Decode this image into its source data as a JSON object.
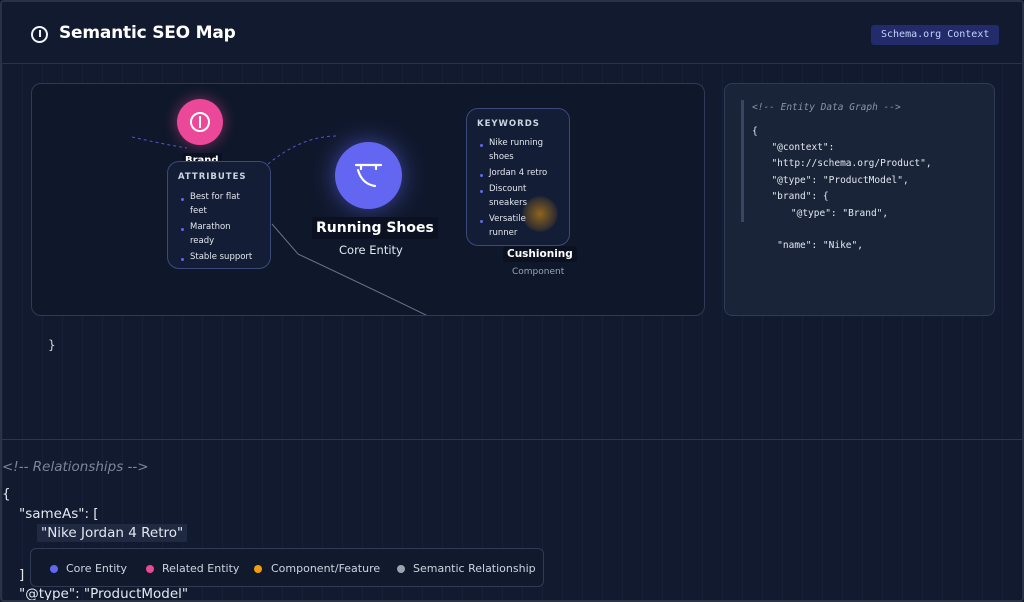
{
  "header": {
    "title": "Semantic SEO Map",
    "badge": "Schema.org Context"
  },
  "map": {
    "brand_label": "Brand",
    "core_label": "Running Shoes",
    "core_sublabel": "Core Entity",
    "component_label": "Cushioning",
    "component_sublabel": "Component",
    "attributes": {
      "title": "ATTRIBUTES",
      "items": [
        "Best for flat",
        "feet",
        "Marathon",
        "ready",
        "Stable support"
      ]
    },
    "keywords": {
      "title": "KEYWORDS",
      "items": [
        "Nike running",
        "shoes",
        "Jordan 4 retro",
        "Discount",
        "sneakers",
        "Versatile",
        "runner"
      ]
    }
  },
  "code": {
    "lines": [
      "<!-- Entity Data Graph -->",
      "{",
      "  \"@context\":",
      "  \"http://schema.org/Product\",",
      "  \"@type\": \"ProductModel\",",
      "  \"brand\": {",
      "    \"@type\": \"Brand\",",
      "",
      "   \"name\": \"Nike\","
    ]
  },
  "overflow": {
    "brace_close": "}",
    "comment": "<!-- Relationships -->",
    "open": "{",
    "same_as": "\"sameAs\": [",
    "same_as_value": "\"Nike Jordan 4 Retro\"",
    "close_bracket": "]",
    "type_line": "\"@type\": \"ProductModel\""
  },
  "legend": {
    "items": [
      {
        "label": "Core Entity",
        "color": "#6366f1"
      },
      {
        "label": "Related Entity",
        "color": "#ec4899"
      },
      {
        "label": "Component/Feature",
        "color": "#f59e0b"
      },
      {
        "label": "Semantic Relationship",
        "color": "#9ca3af"
      }
    ]
  }
}
